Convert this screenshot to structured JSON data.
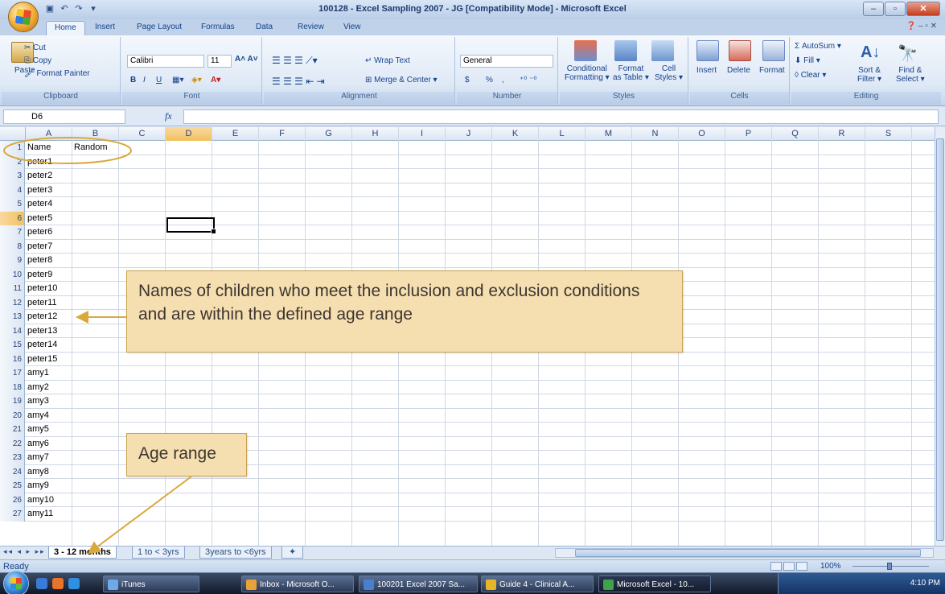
{
  "window": {
    "title": "100128 - Excel Sampling 2007 - JG  [Compatibility Mode] - Microsoft Excel"
  },
  "ribbon_tabs": [
    "Home",
    "Insert",
    "Page Layout",
    "Formulas",
    "Data",
    "Review",
    "View"
  ],
  "clipboard": {
    "paste": "Paste",
    "cut": "Cut",
    "copy": "Copy",
    "format_painter": "Format Painter",
    "label": "Clipboard"
  },
  "font": {
    "name": "Calibri",
    "size": "11",
    "label": "Font",
    "bold": "B",
    "italic": "I",
    "underline": "U"
  },
  "alignment": {
    "wrap_text": "Wrap Text",
    "merge_center": "Merge & Center",
    "label": "Alignment"
  },
  "number": {
    "format": "General",
    "currency": "$",
    "percent": "%",
    "comma": ",",
    "label": "Number"
  },
  "styles": {
    "conditional": "Conditional",
    "conditional2": "Formatting",
    "format_as": "Format",
    "format_as2": "as Table",
    "cell": "Cell",
    "cell2": "Styles",
    "label": "Styles"
  },
  "cells": {
    "insert": "Insert",
    "delete": "Delete",
    "format": "Format",
    "label": "Cells"
  },
  "editing": {
    "autosum": "AutoSum",
    "fill": "Fill",
    "clear": "Clear",
    "sort": "Sort &",
    "sort2": "Filter",
    "find": "Find &",
    "find2": "Select",
    "label": "Editing"
  },
  "formula_bar": {
    "name_box": "D6",
    "fx": "fx",
    "value": ""
  },
  "columns": [
    "A",
    "B",
    "C",
    "D",
    "E",
    "F",
    "G",
    "H",
    "I",
    "J",
    "K",
    "L",
    "M",
    "N",
    "O",
    "P",
    "Q",
    "R",
    "S"
  ],
  "selected_column": "D",
  "selected_row": "6",
  "rows": [
    {
      "n": "1",
      "a": "Name",
      "b": "Random"
    },
    {
      "n": "2",
      "a": "peter1",
      "b": ""
    },
    {
      "n": "3",
      "a": "peter2",
      "b": ""
    },
    {
      "n": "4",
      "a": "peter3",
      "b": ""
    },
    {
      "n": "5",
      "a": "peter4",
      "b": ""
    },
    {
      "n": "6",
      "a": "peter5",
      "b": ""
    },
    {
      "n": "7",
      "a": "peter6",
      "b": ""
    },
    {
      "n": "8",
      "a": "peter7",
      "b": ""
    },
    {
      "n": "9",
      "a": "peter8",
      "b": ""
    },
    {
      "n": "10",
      "a": "peter9",
      "b": ""
    },
    {
      "n": "11",
      "a": "peter10",
      "b": ""
    },
    {
      "n": "12",
      "a": "peter11",
      "b": ""
    },
    {
      "n": "13",
      "a": "peter12",
      "b": ""
    },
    {
      "n": "14",
      "a": "peter13",
      "b": ""
    },
    {
      "n": "15",
      "a": "peter14",
      "b": ""
    },
    {
      "n": "16",
      "a": "peter15",
      "b": ""
    },
    {
      "n": "17",
      "a": "amy1",
      "b": ""
    },
    {
      "n": "18",
      "a": "amy2",
      "b": ""
    },
    {
      "n": "19",
      "a": "amy3",
      "b": ""
    },
    {
      "n": "20",
      "a": "amy4",
      "b": ""
    },
    {
      "n": "21",
      "a": "amy5",
      "b": ""
    },
    {
      "n": "22",
      "a": "amy6",
      "b": ""
    },
    {
      "n": "23",
      "a": "amy7",
      "b": ""
    },
    {
      "n": "24",
      "a": "amy8",
      "b": ""
    },
    {
      "n": "25",
      "a": "amy9",
      "b": ""
    },
    {
      "n": "26",
      "a": "amy10",
      "b": ""
    },
    {
      "n": "27",
      "a": "amy11",
      "b": ""
    }
  ],
  "sheet_tabs": [
    "3 - 12 months",
    "1 to < 3yrs",
    "3years to <6yrs"
  ],
  "status": {
    "text": "Ready",
    "zoom": "100%"
  },
  "taskbar": {
    "items": [
      "iTunes",
      "Inbox - Microsoft O...",
      "100201 Excel 2007 Sa...",
      "Guide 4 - Clinical A...",
      "Microsoft Excel - 10..."
    ],
    "clock": "4:10 PM"
  },
  "annotations": {
    "names_callout": "Names of children who meet the inclusion and exclusion conditions and are within the defined age range",
    "age_callout": "Age range"
  },
  "colors": {
    "callout_fill": "#f5deb0",
    "callout_border": "#c8a24c",
    "arrow": "#d9a93a",
    "selected_header": "#f1c15f"
  }
}
